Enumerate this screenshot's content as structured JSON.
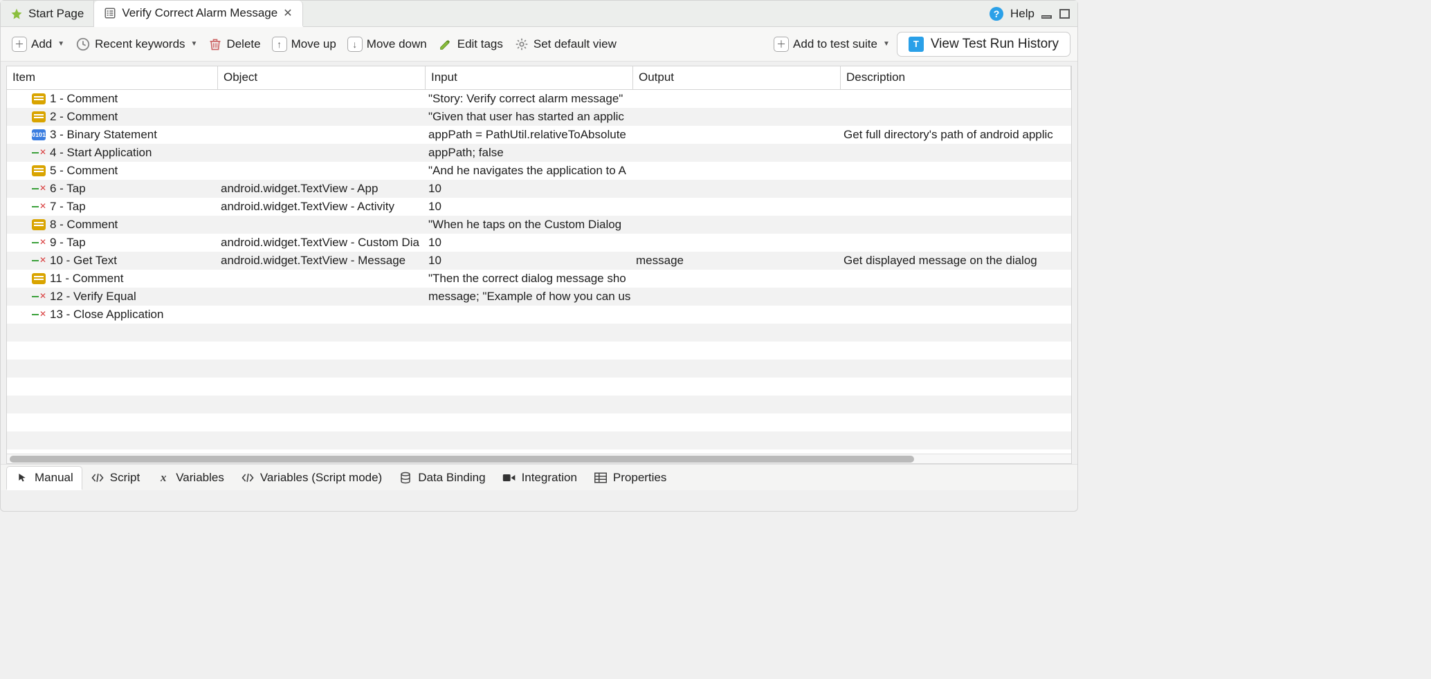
{
  "tabs": [
    {
      "label": "Start Page",
      "active": false
    },
    {
      "label": "Verify Correct Alarm Message",
      "active": true
    }
  ],
  "help_label": "Help",
  "toolbar": {
    "add": "Add",
    "recent": "Recent keywords",
    "delete": "Delete",
    "move_up": "Move up",
    "move_down": "Move down",
    "edit_tags": "Edit tags",
    "set_default": "Set default view",
    "add_to_suite": "Add to test suite",
    "view_history": "View Test Run History"
  },
  "columns": {
    "item": "Item",
    "object": "Object",
    "input": "Input",
    "output": "Output",
    "description": "Description"
  },
  "rows": [
    {
      "icon": "comment",
      "item": "1 - Comment",
      "object": "",
      "input": "\"Story: Verify correct alarm message\"",
      "output": "",
      "desc": ""
    },
    {
      "icon": "comment",
      "item": "2 - Comment",
      "object": "",
      "input": "\"Given that user has started an applic",
      "output": "",
      "desc": ""
    },
    {
      "icon": "binary",
      "item": "3 - Binary Statement",
      "object": "",
      "input": "appPath = PathUtil.relativeToAbsolute",
      "output": "",
      "desc": "Get full directory's path of android applic"
    },
    {
      "icon": "action",
      "item": "4 - Start Application",
      "object": "",
      "input": "appPath; false",
      "output": "",
      "desc": ""
    },
    {
      "icon": "comment",
      "item": "5 - Comment",
      "object": "",
      "input": "\"And he navigates the application to A",
      "output": "",
      "desc": ""
    },
    {
      "icon": "action",
      "item": "6 - Tap",
      "object": "android.widget.TextView - App",
      "input": "10",
      "output": "",
      "desc": ""
    },
    {
      "icon": "action",
      "item": "7 - Tap",
      "object": "android.widget.TextView - Activity",
      "input": "10",
      "output": "",
      "desc": ""
    },
    {
      "icon": "comment",
      "item": "8 - Comment",
      "object": "",
      "input": "\"When he taps on the Custom Dialog",
      "output": "",
      "desc": ""
    },
    {
      "icon": "action",
      "item": "9 - Tap",
      "object": "android.widget.TextView - Custom Dia",
      "input": "10",
      "output": "",
      "desc": ""
    },
    {
      "icon": "action",
      "item": "10 - Get Text",
      "object": "android.widget.TextView - Message",
      "input": "10",
      "output": "message",
      "desc": "Get displayed message on the dialog"
    },
    {
      "icon": "comment",
      "item": "11 - Comment",
      "object": "",
      "input": "\"Then the correct dialog message sho",
      "output": "",
      "desc": ""
    },
    {
      "icon": "action",
      "item": "12 - Verify Equal",
      "object": "",
      "input": "message; \"Example of how you can us",
      "output": "",
      "desc": ""
    },
    {
      "icon": "action",
      "item": "13 - Close Application",
      "object": "",
      "input": "",
      "output": "",
      "desc": ""
    }
  ],
  "bottom_tabs": {
    "manual": "Manual",
    "script": "Script",
    "variables": "Variables",
    "variables_script": "Variables (Script mode)",
    "data_binding": "Data Binding",
    "integration": "Integration",
    "properties": "Properties"
  }
}
